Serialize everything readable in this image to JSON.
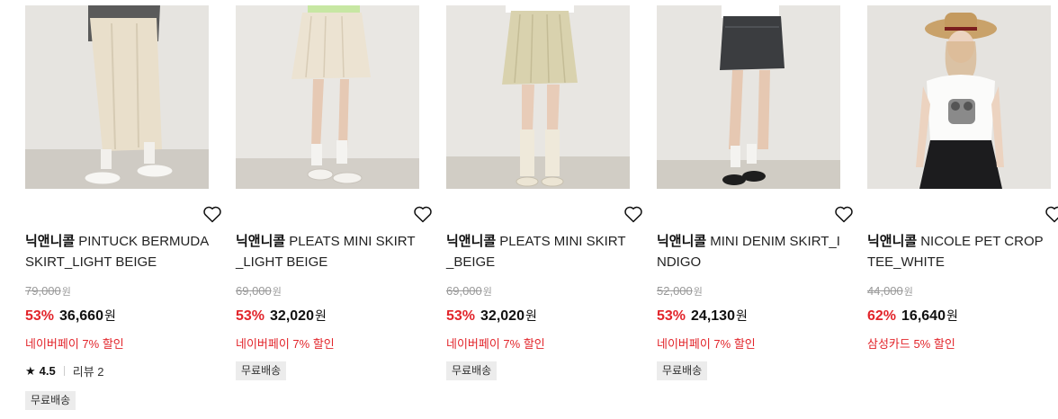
{
  "products": [
    {
      "brand": "닉앤니콜",
      "name": "PINTUCK BERMUDA SKIRT_LIGHT BEIGE",
      "original_price": "79,000",
      "currency": "원",
      "discount_rate": "53%",
      "sale_price": "36,660",
      "benefit": "네이버페이 7% 할인",
      "rating": "4.5",
      "review_label": "리뷰 2",
      "shipping_tag": "무료배송",
      "image_icon": "product-photo-pintuck-bermuda-skirt"
    },
    {
      "brand": "닉앤니콜",
      "name": "PLEATS MINI SKIRT_LIGHT BEIGE",
      "original_price": "69,000",
      "currency": "원",
      "discount_rate": "53%",
      "sale_price": "32,020",
      "benefit": "네이버페이 7% 할인",
      "shipping_tag": "무료배송",
      "image_icon": "product-photo-pleats-mini-skirt-light-beige"
    },
    {
      "brand": "닉앤니콜",
      "name": "PLEATS MINI SKIRT_BEIGE",
      "original_price": "69,000",
      "currency": "원",
      "discount_rate": "53%",
      "sale_price": "32,020",
      "benefit": "네이버페이 7% 할인",
      "shipping_tag": "무료배송",
      "image_icon": "product-photo-pleats-mini-skirt-beige"
    },
    {
      "brand": "닉앤니콜",
      "name": "MINI DENIM SKIRT_INDIGO",
      "original_price": "52,000",
      "currency": "원",
      "discount_rate": "53%",
      "sale_price": "24,130",
      "benefit": "네이버페이 7% 할인",
      "shipping_tag": "무료배송",
      "image_icon": "product-photo-mini-denim-skirt"
    },
    {
      "brand": "닉앤니콜",
      "name": "NICOLE PET CROP TEE_WHITE",
      "original_price": "44,000",
      "currency": "원",
      "discount_rate": "62%",
      "sale_price": "16,640",
      "benefit": "삼성카드 5% 할인",
      "image_icon": "product-photo-nicole-pet-crop-tee"
    }
  ],
  "colors": {
    "accent_red": "#e2252b",
    "muted_price": "#999999",
    "tag_bg": "#ececec"
  }
}
